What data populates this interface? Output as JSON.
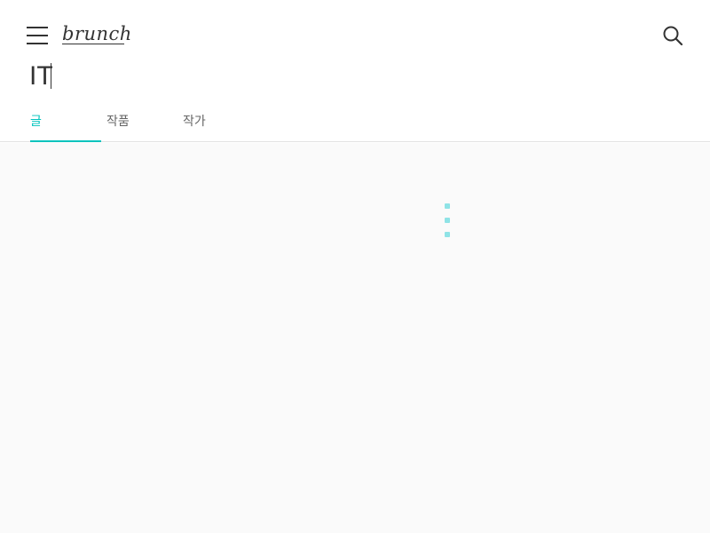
{
  "header": {
    "logo_text": "brunch",
    "menu_icon": "hamburger-menu-icon",
    "search_icon": "search-icon"
  },
  "search": {
    "query": "IT"
  },
  "tabs": [
    {
      "label": "글",
      "active": true
    },
    {
      "label": "작품",
      "active": false
    },
    {
      "label": "작가",
      "active": false
    }
  ],
  "colors": {
    "accent": "#00c3bd",
    "loading": "#8fe3e6",
    "content_bg": "#fafafa",
    "text": "#333333"
  },
  "loading_icon": "vertical-dots-loading-icon"
}
